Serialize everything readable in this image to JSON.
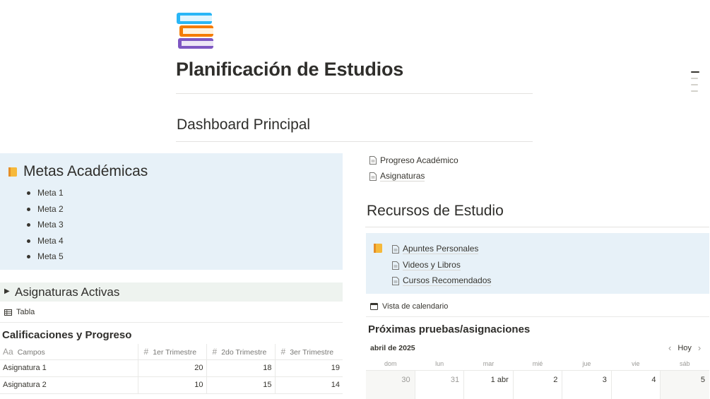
{
  "page": {
    "title": "Planificación de Estudios",
    "icon": "books-icon"
  },
  "dashboard": {
    "heading": "Dashboard Principal"
  },
  "goals": {
    "title": "Metas Académicas",
    "icon": "notebook-icon",
    "items": [
      "Meta 1",
      "Meta 2",
      "Meta 3",
      "Meta 4",
      "Meta 5"
    ]
  },
  "links": {
    "progress": "Progreso Académico",
    "subjects": "Asignaturas"
  },
  "toggle": {
    "label": "Asignaturas Activas"
  },
  "table_view": {
    "tab_label": "Tabla",
    "title": "Calificaciones y Progreso",
    "columns": {
      "name_icon": "Aa",
      "name": "Campos",
      "t1": "1er Trimestre",
      "t2": "2do Trimestre",
      "t3": "3er Trimestre"
    },
    "rows": [
      {
        "name": "Asignatura 1",
        "t1": "20",
        "t2": "18",
        "t3": "19"
      },
      {
        "name": "Asignatura 2",
        "t1": "10",
        "t2": "15",
        "t3": "14"
      }
    ]
  },
  "resources": {
    "heading": "Recursos de Estudio",
    "icon": "notebook-icon",
    "items": [
      "Apuntes Personales",
      "Videos y Libros",
      "Cursos Recomendados"
    ]
  },
  "calendar": {
    "view_label": "Vista de calendario",
    "title": "Próximas pruebas/asignaciones",
    "month": "abril de 2025",
    "today_label": "Hoy",
    "weekdays": [
      "dom",
      "lun",
      "mar",
      "mié",
      "jue",
      "vie",
      "sáb"
    ],
    "days": [
      "30",
      "31",
      "1 abr",
      "2",
      "3",
      "4",
      "5"
    ]
  },
  "colors": {
    "callout_blue": "#e7f1f8",
    "toggle_green": "#eef3ef",
    "text": "#37352f"
  }
}
